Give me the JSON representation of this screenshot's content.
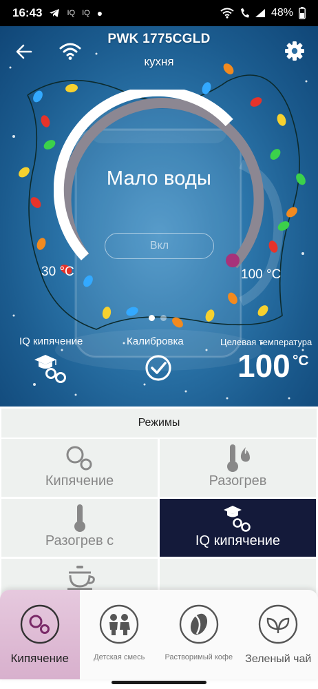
{
  "status_bar": {
    "time": "16:43",
    "left_icons": [
      "telegram-icon",
      "iq-icon",
      "iq-icon",
      "dot-icon"
    ],
    "right_icons": [
      "wifi-icon",
      "call-icon",
      "signal-icon",
      "battery-icon"
    ],
    "battery": "48%"
  },
  "header": {
    "title": "PWK 1775CGLD",
    "room": "кухня",
    "back_icon": "arrow-left-icon",
    "wifi_icon": "wifi-icon",
    "settings_icon": "gear-icon"
  },
  "dial": {
    "status": "Мало воды",
    "button_label": "Вкл",
    "min_label": "30 °C",
    "max_label": "100 °C",
    "track_color": "#8c8792",
    "active_color": "#ffffff",
    "knob_color": "#a8327a"
  },
  "pager": {
    "count": 2,
    "active": 0
  },
  "features": {
    "iq_label": "IQ кипячение",
    "calibration_label": "Калибровка",
    "target_label": "Целевая температура",
    "target_value": "100",
    "target_unit": "°C"
  },
  "modes": {
    "header": "Режимы",
    "items": [
      {
        "label": "Кипячение",
        "icon": "bubbles-icon",
        "selected": false
      },
      {
        "label": "Разогрев",
        "icon": "thermometer-flame-icon",
        "selected": false
      },
      {
        "label": "Разогрев с",
        "icon": "thermometer-icon",
        "selected": false
      },
      {
        "label": "IQ кипячение",
        "icon": "graduation-bubbles-icon",
        "selected": true
      },
      {
        "label": "",
        "icon": "teapot-icon",
        "selected": false
      }
    ],
    "selected_color": "#141a3a"
  },
  "dock": {
    "items": [
      {
        "label": "Кипячение",
        "icon": "bubbles-icon",
        "active": true
      },
      {
        "label": "Детская смесь",
        "icon": "children-icon",
        "active": false
      },
      {
        "label": "Растворимый кофе",
        "icon": "coffee-bean-icon",
        "active": false
      },
      {
        "label": "Зеленый чай",
        "icon": "leaves-icon",
        "active": false
      }
    ]
  }
}
